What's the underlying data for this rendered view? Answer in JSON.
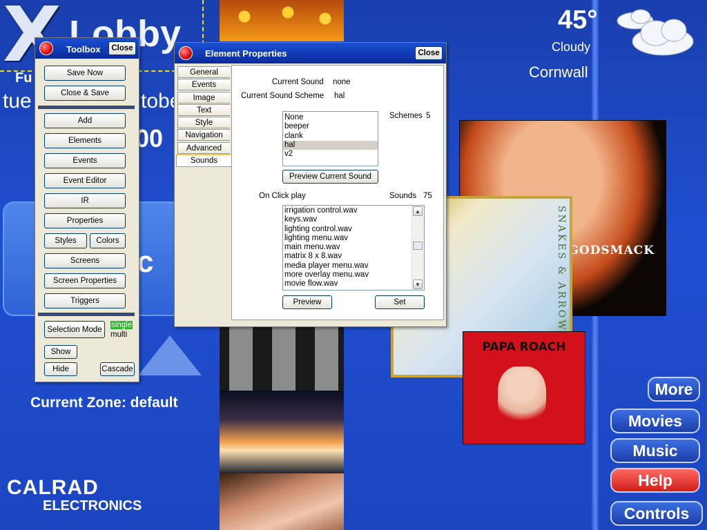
{
  "background": {
    "logo_letter": "X",
    "lobby_title": "Lobby",
    "partial_fu": "Fu",
    "partial_date": "tue",
    "partial_date_right": "tobe",
    "partial_time": "00",
    "partial_c": "c",
    "current_zone": "Current Zone: default",
    "brand_line1": "CALRAD",
    "brand_line2": "ELECTRONICS"
  },
  "weather": {
    "temperature": "45°",
    "condition": "Cloudy",
    "city": "Cornwall",
    "icon": "cloud-icon"
  },
  "albums": {
    "godsmack": "GODSMACK",
    "snakes": "SNAKES & ARROWS",
    "papa_roach": "PAPA ROACH"
  },
  "nav_buttons": [
    {
      "label": "More"
    },
    {
      "label": "Movies"
    },
    {
      "label": "Music"
    },
    {
      "label": "Help"
    },
    {
      "label": "Controls"
    }
  ],
  "toolbox": {
    "title": "Toolbox",
    "close": "Close",
    "save_now": "Save Now",
    "close_save": "Close & Save",
    "add": "Add",
    "elements": "Elements",
    "events": "Events",
    "event_editor": "Event Editor",
    "ir": "IR",
    "properties": "Properties",
    "styles": "Styles",
    "colors": "Colors",
    "screens": "Screens",
    "screen_properties": "Screen Properties",
    "triggers": "Triggers",
    "selection_mode": "Selection Mode",
    "mode_single": "single",
    "mode_multi": "multi",
    "show": "Show",
    "hide": "Hide",
    "cascade": "Cascade"
  },
  "props": {
    "title": "Element Properties",
    "close": "Close",
    "tabs": [
      "General",
      "Events",
      "Image",
      "Text",
      "Style",
      "Navigation",
      "Advanced",
      "Sounds"
    ],
    "current_sound_label": "Current Sound",
    "current_sound_value": "none",
    "scheme_label": "Current Sound Scheme",
    "scheme_value": "hal",
    "schemes_label": "Schemes",
    "schemes_count": "5",
    "schemes": [
      "None",
      "beeper",
      "clank",
      "hal",
      "v2"
    ],
    "preview_current": "Preview Current Sound",
    "on_click_label": "On Click play",
    "sounds_label": "Sounds",
    "sounds_count": "75",
    "sounds": [
      "irrigation control.wav",
      "keys.wav",
      "lighting control.wav",
      "lighting menu.wav",
      "main menu.wav",
      "matrix 8 x 8.wav",
      "media player menu.wav",
      "more overlay menu.wav",
      "movie flow.wav"
    ],
    "preview": "Preview",
    "set": "Set"
  }
}
